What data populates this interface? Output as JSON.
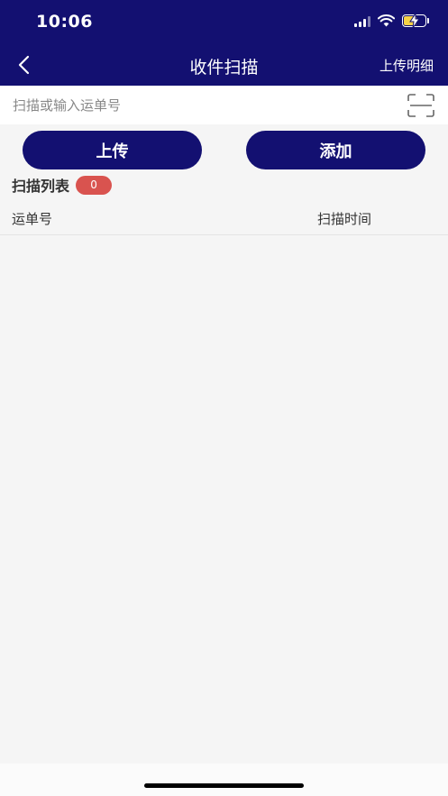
{
  "status_bar": {
    "time": "10:06"
  },
  "navbar": {
    "title": "收件扫描",
    "right_action": "上传明细"
  },
  "search": {
    "placeholder": "扫描或输入运单号",
    "value": ""
  },
  "actions": {
    "upload_label": "上传",
    "add_label": "添加"
  },
  "scan_list": {
    "title": "扫描列表",
    "count": "0",
    "columns": [
      "运单号",
      "扫描时间"
    ],
    "rows": []
  },
  "colors": {
    "primary": "#131071",
    "badge": "#d9534f",
    "background": "#f5f5f5"
  }
}
